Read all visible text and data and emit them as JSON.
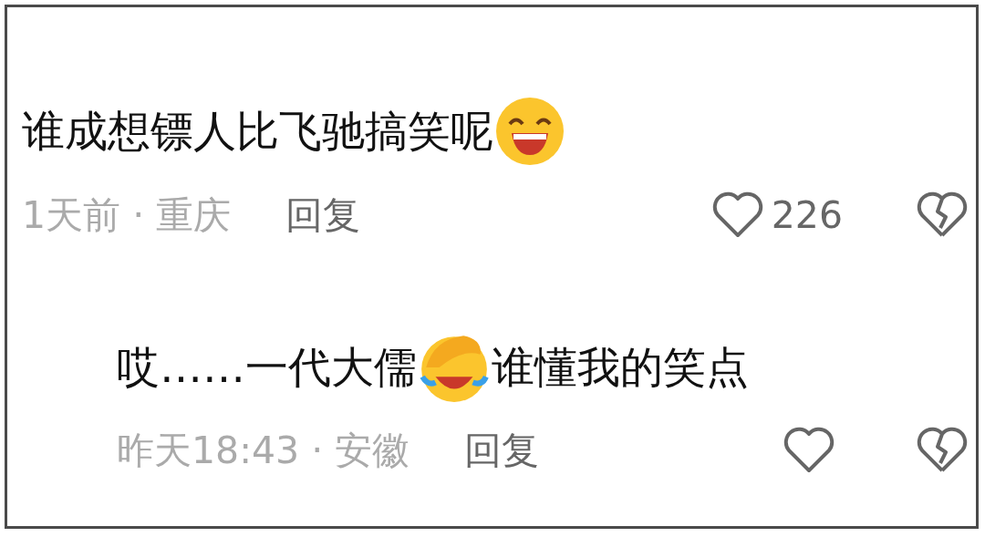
{
  "comments": [
    {
      "parts": [
        {
          "kind": "text",
          "text": "谁成想镖人比飞驰搞笑呢"
        },
        {
          "kind": "grin"
        }
      ],
      "time": "1天前",
      "separator": "·",
      "location": "重庆",
      "reply": "回复",
      "likes": "226",
      "reply_level": false
    },
    {
      "parts": [
        {
          "kind": "text",
          "text": "哎……一代大儒"
        },
        {
          "kind": "facepalm"
        },
        {
          "kind": "text",
          "text": "谁懂我的笑点"
        }
      ],
      "time": "昨天18:43",
      "separator": "·",
      "location": "安徽",
      "reply": "回复",
      "reply_level": true
    }
  ]
}
